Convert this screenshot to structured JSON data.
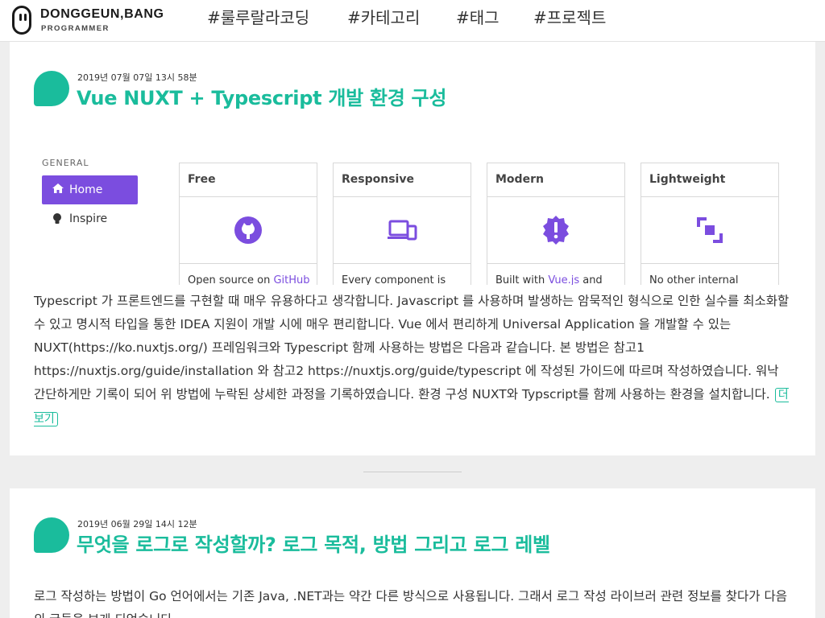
{
  "brand": {
    "name": "DONGGEUN,BANG",
    "subtitle": "PROGRAMMER"
  },
  "nav": [
    {
      "label": "#룰루랄라코딩"
    },
    {
      "label": "#카테고리"
    },
    {
      "label": "#태그"
    },
    {
      "label": "#프로젝트"
    }
  ],
  "posts": [
    {
      "date": "2019년 07월 07일 13시 58분",
      "title": "Vue NUXT + Typescript 개발 환경 구성",
      "preview": {
        "section_label": "GENERAL",
        "menu": [
          {
            "label": "Home",
            "icon": "home-icon"
          },
          {
            "label": "Inspire",
            "icon": "lightbulb-icon"
          }
        ],
        "cards": [
          {
            "title": "Free",
            "icon": "github-icon",
            "text": "Open source on ",
            "link": "GitHub",
            "text_after": ""
          },
          {
            "title": "Responsive",
            "icon": "devices-icon",
            "text": "Every component is",
            "link": "",
            "text_after": ""
          },
          {
            "title": "Modern",
            "icon": "alert-badge-icon",
            "text": "Built with ",
            "link": "Vue.js",
            "text_after": " and"
          },
          {
            "title": "Lightweight",
            "icon": "compress-icon",
            "text": "No other internal",
            "link": "",
            "text_after": ""
          }
        ],
        "accent_color": "#7b4ddf"
      },
      "excerpt": "Typescript 가 프론트엔드를 구현할 때 매우 유용하다고 생각합니다. Javascript 를 사용하며 발생하는 암묵적인 형식으로 인한 실수를 최소화할 수 있고 명시적 타입을 통한 IDEA 지원이 개발 시에 매우 편리합니다. Vue 에서 편리하게 Universal Application 을 개발할 수 있는 NUXT(https://ko.nuxtjs.org/) 프레임워크와 Typescript 함께 사용하는 방법은 다음과 같습니다. 본 방법은 참고1 https://nuxtjs.org/guide/installation 와 참고2 https://nuxtjs.org/guide/typescript 에 작성된 가이드에 따르며 작성하였습니다. 워낙 간단하게만 기록이 되어 위 방법에 누락된 상세한 과정을 기록하였습니다. 환경 구성 NUXT와 Typscript를 함께 사용하는 환경을 설치합니다.",
      "more_label": "더보기"
    },
    {
      "date": "2019년 06월 29일 14시 12분",
      "title": "무엇을 로그로 작성할까? 로그 목적, 방법 그리고 로그 레벨",
      "excerpt": "로그 작성하는 방법이 Go 언어에서는 기존 Java, .NET과는 약간 다른 방식으로 사용됩니다. 그래서 로그 작성 라이브러 관련 정보를 찾다가 다음의 글들을 보게 되었습니다."
    }
  ],
  "colors": {
    "accent": "#1abc9c",
    "background": "#eeeeee"
  }
}
